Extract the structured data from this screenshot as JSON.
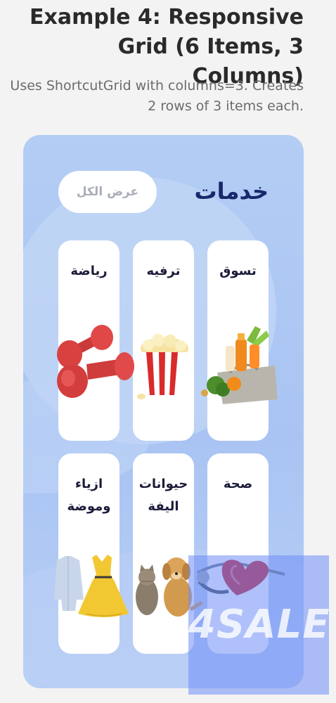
{
  "page": {
    "title": "Example 4: Responsive Grid (6 Items, 3 Columns)",
    "description": "Uses ShortcutGrid with columns=3. Creates 2 rows of 3 items each."
  },
  "card": {
    "header_title": "خدمات",
    "view_all_label": "عرض الكل"
  },
  "tiles": [
    {
      "label": "تسوق",
      "icon": "grocery-bag-icon"
    },
    {
      "label": "ترفيه",
      "icon": "popcorn-icon"
    },
    {
      "label": "رياضة",
      "icon": "dumbbell-icon"
    },
    {
      "label": "صحة",
      "icon": "stethoscope-heart-icon"
    },
    {
      "label": "حيوانات\nاليفة",
      "icon": "pets-icon"
    },
    {
      "label": "ازياء\nوموضة",
      "icon": "fashion-icon"
    }
  ],
  "watermark": {
    "text": "4SALE"
  },
  "colors": {
    "card_background": "#b3cdf4",
    "header_title": "#19276b",
    "view_all_text": "#a9aeb9",
    "watermark": "#6e8cf5"
  }
}
